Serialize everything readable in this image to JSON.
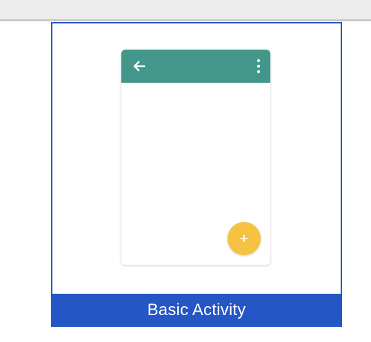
{
  "template": {
    "name": "Basic Activity",
    "selected": true
  },
  "preview": {
    "app_bar": {
      "navigation_icon": "back-arrow-icon",
      "menu_icon": "overflow-menu-icon"
    },
    "fab": {
      "icon": "plus-icon",
      "glyph": "+"
    }
  },
  "colors": {
    "selection_border": "#2457c5",
    "label_background": "#2457c5",
    "app_bar": "#42968a",
    "fab": "#f5c242"
  }
}
